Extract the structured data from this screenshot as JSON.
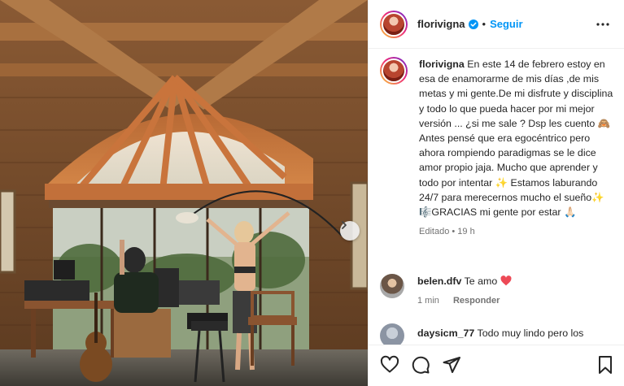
{
  "post": {
    "username": "florivigna",
    "follow_label": "Seguir",
    "separator": "•",
    "caption": {
      "text": "En este 14 de febrero estoy en esa de enamorarme de mis días ,de mis metas y mi gente.De mi disfrute y disciplina y todo lo que pueda hacer por mi mejor versión ... ¿si me sale ? Dsp les cuento 🙈 Antes pensé que era egocéntrico pero ahora rompiendo paradigmas se le dice amor propio jaja. Mucho que aprender y todo por intentar ✨ Estamos laburando 24/7 para merecernos mucho el sueño✨ 🎼GRACIAS mi gente por estar 🙏🏻",
      "edited": "Editado",
      "time": "19 h"
    },
    "comments": [
      {
        "username": "belen.dfv",
        "text": "Te amo",
        "time": "1 min",
        "reply_label": "Responder"
      },
      {
        "username": "daysicm_77",
        "text": "Todo muy lindo pero los"
      }
    ]
  },
  "icons": {
    "verified": "verified-badge-icon",
    "more": "more-options-icon",
    "next": "chevron-right-icon",
    "like": "heart-icon",
    "comment": "comment-icon",
    "share": "send-icon",
    "save": "bookmark-icon",
    "heart_emoji": "red-heart-icon"
  },
  "colors": {
    "accent": "#0095f6",
    "text": "#262626",
    "muted": "#737373",
    "heart": "#ed4956"
  }
}
